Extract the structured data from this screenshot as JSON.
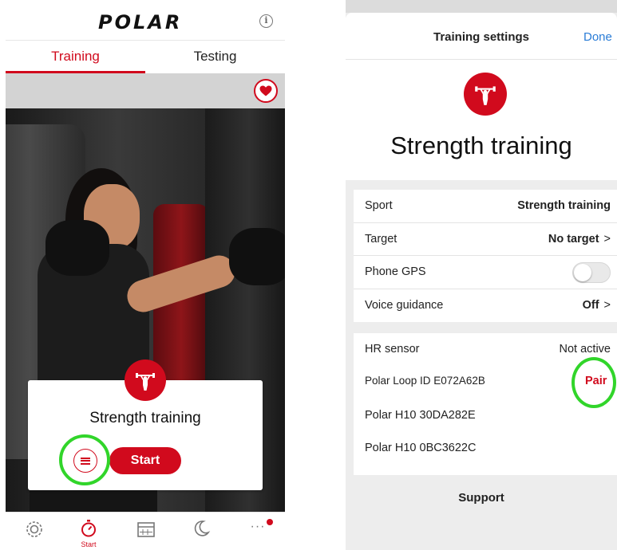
{
  "left_phone": {
    "brand": "POLAR",
    "tabs": [
      {
        "label": "Training",
        "active": true
      },
      {
        "label": "Testing",
        "active": false
      }
    ],
    "card": {
      "sport_title": "Strength training",
      "start_label": "Start"
    },
    "bottom_nav": {
      "start_label": "Start",
      "more_label": "···"
    }
  },
  "right_phone": {
    "header": {
      "title": "Training settings",
      "done_label": "Done"
    },
    "hero_title": "Strength training",
    "settings": [
      {
        "label": "Sport",
        "value": "Strength training"
      },
      {
        "label": "Target",
        "value": "No target",
        "chevron": ">"
      },
      {
        "label": "Phone GPS",
        "toggle": false
      },
      {
        "label": "Voice guidance",
        "value": "Off",
        "chevron": ">"
      }
    ],
    "sensors": {
      "label": "HR sensor",
      "status": "Not active",
      "devices": [
        {
          "name": "Polar Loop  ID E072A62B",
          "action": "Pair"
        },
        {
          "name": "Polar H10 30DA282E"
        },
        {
          "name": "Polar H10 0BC3622C"
        }
      ]
    },
    "support_label": "Support"
  },
  "colors": {
    "accent": "#d10a1d",
    "link": "#2a7cd6",
    "highlight_ring": "#31d52a"
  }
}
